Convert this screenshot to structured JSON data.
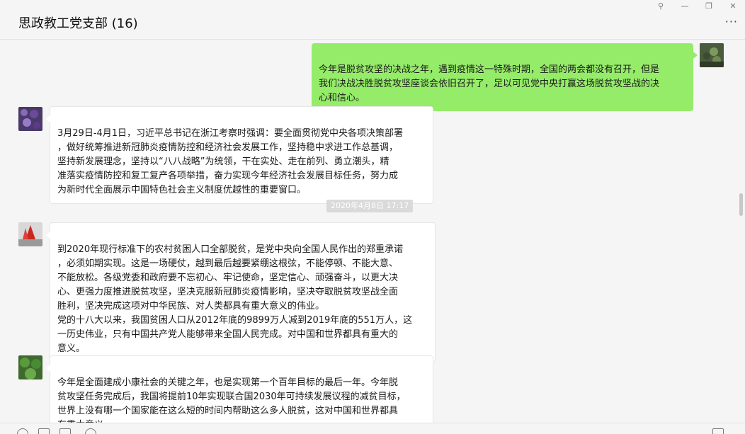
{
  "chat": {
    "title": "思政教工党支部 (16)",
    "more_label": "···"
  },
  "window_controls": {
    "pin": "⚲",
    "minimize": "—",
    "restore": "❐",
    "close": "✕"
  },
  "messages": [
    {
      "direction": "out",
      "text": "今年是脱贫攻坚的决战之年，遇到疫情这一特殊时期，全国的两会都没有召开，但是\n我们决战决胜脱贫攻坚座谈会依旧召开了，足以可见党中央打赢这场脱贫攻坚战的决\n心和信心。"
    },
    {
      "direction": "in",
      "text": "3月29日-4月1日，习近平总书记在浙江考察时强调：要全面贯彻党中央各项决策部署\n，做好统筹推进新冠肺炎疫情防控和经济社会发展工作，坚持稳中求进工作总基调，\n坚持新发展理念，坚持以“八八战略”为统领，干在实处、走在前列、勇立潮头，精\n准落实疫情防控和复工复产各项举措，奋力实现今年经济社会发展目标任务，努力成\n为新时代全面展示中国特色社会主义制度优越性的重要窗口。"
    },
    {
      "direction": "in",
      "text": "到2020年现行标准下的农村贫困人口全部脱贫，是党中央向全国人民作出的郑重承诺\n，必须如期实现。这是一场硬仗，越到最后越要紧绷这根弦，不能停顿、不能大意、\n不能放松。各级党委和政府要不忘初心、牢记使命，坚定信心、顽强奋斗，以更大决\n心、更强力度推进脱贫攻坚，坚决克服新冠肺炎疫情影响，坚决夺取脱贫攻坚战全面\n胜利，坚决完成这项对中华民族、对人类都具有重大意义的伟业。\n党的十八大以来，我国贫困人口从2012年底的9899万人减到2019年底的551万人，这\n一历史伟业，只有中国共产党人能够带来全国人民完成。对中国和世界都具有重大的\n意义。"
    },
    {
      "direction": "in",
      "text": "今年是全面建成小康社会的关键之年，也是实现第一个百年目标的最后一年。今年脱\n贫攻坚任务完成后，我国将提前10年实现联合国2030年可持续发展议程的减贫目标，\n世界上没有哪一个国家能在这么短的时间内帮助这么多人脱贫，这对中国和世界都具\n有重大意义。"
    }
  ],
  "timestamp": "2020年4月8日 17:17",
  "colors": {
    "outgoing_bubble": "#95ec69",
    "incoming_bubble": "#ffffff",
    "background": "#f5f5f5"
  }
}
